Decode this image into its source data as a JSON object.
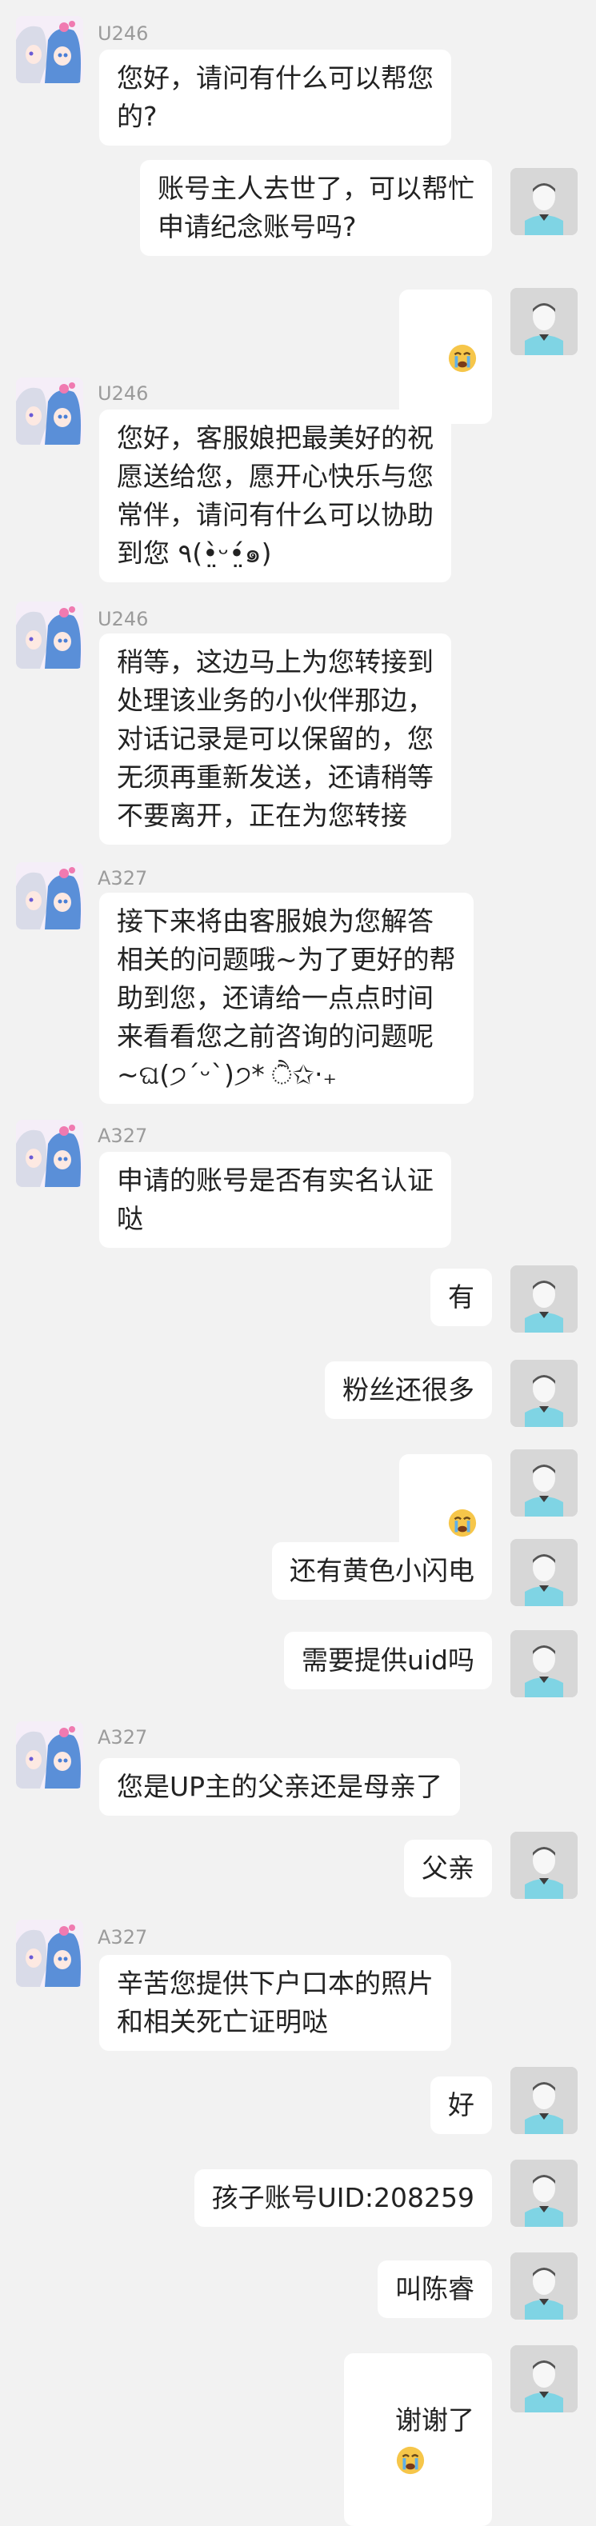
{
  "messages": [
    {
      "side": "agent",
      "sender": "U246",
      "text": "您好，请问有什么可以帮您\n的?"
    },
    {
      "side": "user",
      "text": "账号主人去世了，可以帮忙\n申请纪念账号吗?"
    },
    {
      "side": "user",
      "emoji": "crying-face"
    },
    {
      "side": "agent",
      "sender": "U246",
      "text": "您好，客服娘把最美好的祝\n愿送给您，愿开心快乐与您\n常伴，请问有什么可以协助\n到您 ٩(•̤̀ᵕ•̤́๑)"
    },
    {
      "side": "agent",
      "sender": "U246",
      "text": "稍等，这边马上为您转接到\n处理该业务的小伙伴那边，\n对话记录是可以保留的，您\n无须再重新发送，还请稍等\n不要离开，正在为您转接"
    },
    {
      "side": "agent",
      "sender": "A327",
      "text": "接下来将由客服娘为您解答\n相关的问题哦~为了更好的帮\n助到您，还请给一点点时间\n来看看您之前咨询的问题呢\n~ଘ(੭ˊᵕˋ)੭* ੈ✩‧₊"
    },
    {
      "side": "agent",
      "sender": "A327",
      "text": "申请的账号是否有实名认证\n哒"
    },
    {
      "side": "user",
      "text": "有"
    },
    {
      "side": "user",
      "text": "粉丝还很多"
    },
    {
      "side": "user",
      "emoji": "crying-face"
    },
    {
      "side": "user",
      "text": "还有黄色小闪电"
    },
    {
      "side": "user",
      "text": "需要提供uid吗"
    },
    {
      "side": "agent",
      "sender": "A327",
      "text": "您是UP主的父亲还是母亲了"
    },
    {
      "side": "user",
      "text": "父亲"
    },
    {
      "side": "agent",
      "sender": "A327",
      "text": "辛苦您提供下户口本的照片\n和相关死亡证明哒"
    },
    {
      "side": "user",
      "text": "好"
    },
    {
      "side": "user",
      "text": "孩子账号UID:208259"
    },
    {
      "side": "user",
      "text": "叫陈睿"
    },
    {
      "side": "user",
      "text": "谢谢了",
      "emoji": "crying-face"
    }
  ]
}
